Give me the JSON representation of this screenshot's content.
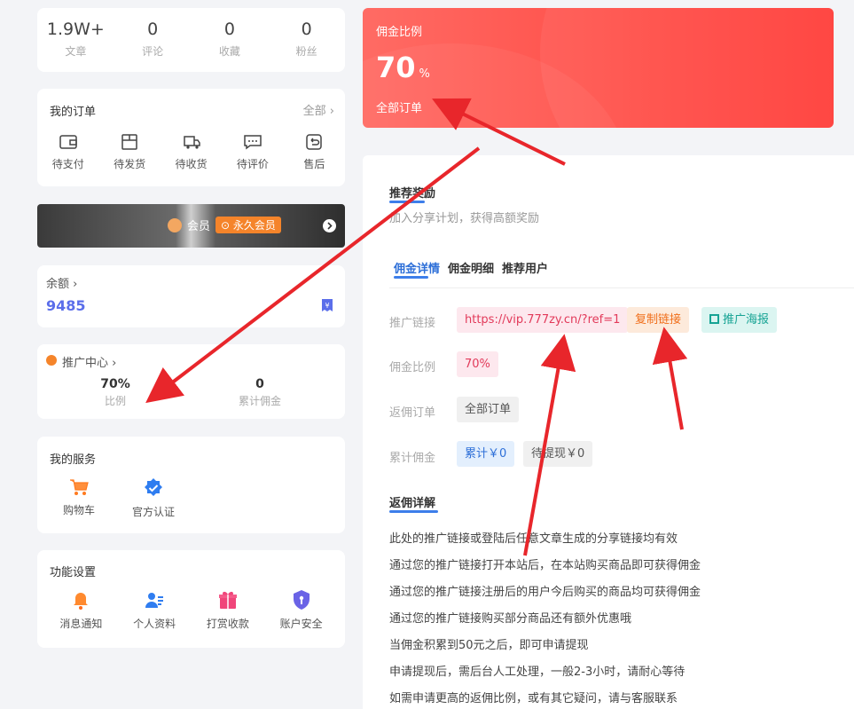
{
  "stats": [
    {
      "value": "1.9W+",
      "label": "文章"
    },
    {
      "value": "0",
      "label": "评论"
    },
    {
      "value": "0",
      "label": "收藏"
    },
    {
      "value": "0",
      "label": "粉丝"
    }
  ],
  "orders": {
    "title": "我的订单",
    "more": "全部 ›",
    "items": [
      {
        "label": "待支付",
        "icon": "wallet-icon"
      },
      {
        "label": "待发货",
        "icon": "box-icon"
      },
      {
        "label": "待收货",
        "icon": "truck-icon"
      },
      {
        "label": "待评价",
        "icon": "chat-icon"
      },
      {
        "label": "售后",
        "icon": "return-icon"
      }
    ]
  },
  "vip": {
    "label": "会员",
    "badge": "⊙ 永久会员"
  },
  "balance": {
    "label": "余额 ›",
    "value": "9485"
  },
  "promo": {
    "label": "推广中心 ›",
    "ratio_value": "70%",
    "ratio_label": "比例",
    "total_value": "0",
    "total_label": "累计佣金"
  },
  "services": {
    "title": "我的服务",
    "items": [
      {
        "label": "购物车",
        "icon": "cart-icon"
      },
      {
        "label": "官方认证",
        "icon": "verified-icon"
      }
    ]
  },
  "settings": {
    "title": "功能设置",
    "items": [
      {
        "label": "消息通知",
        "icon": "bell-icon"
      },
      {
        "label": "个人资料",
        "icon": "user-icon"
      },
      {
        "label": "打赏收款",
        "icon": "gift-icon"
      },
      {
        "label": "账户安全",
        "icon": "shield-icon"
      }
    ]
  },
  "commission": {
    "title": "佣金比例",
    "value": "70",
    "unit": "%",
    "footer": "全部订单"
  },
  "reward": {
    "title": "推荐奖励",
    "subtitle": "加入分享计划，获得高额奖励",
    "tabs": [
      "佣金详情",
      "佣金明细",
      "推荐用户"
    ],
    "link_label": "推广链接",
    "link_value": "https://vip.777zy.cn/?ref=1",
    "copy_button": "复制链接",
    "poster_button": "推广海报",
    "ratio_label": "佣金比例",
    "ratio_value": "70%",
    "orders_label": "返佣订单",
    "orders_value": "全部订单",
    "total_label": "累计佣金",
    "total_value": "累计￥0",
    "pending_value": "待提现￥0"
  },
  "rules": {
    "title": "返佣详解",
    "lines": [
      "此处的推广链接或登陆后任意文章生成的分享链接均有效",
      "通过您的推广链接打开本站后，在本站购买商品即可获得佣金",
      "通过您的推广链接注册后的用户今后购买的商品均可获得佣金",
      "通过您的推广链接购买部分商品还有额外优惠哦",
      "当佣金积累到50元之后，即可申请提现",
      "申请提现后，需后台人工处理，一般2-3小时，请耐心等待",
      "如需申请更高的返佣比例，或有其它疑问，请与客服联系"
    ]
  },
  "colors": {
    "accent": "#3d7eea",
    "commission_bg": "#ff4d47",
    "arrow": "#e8262b"
  }
}
